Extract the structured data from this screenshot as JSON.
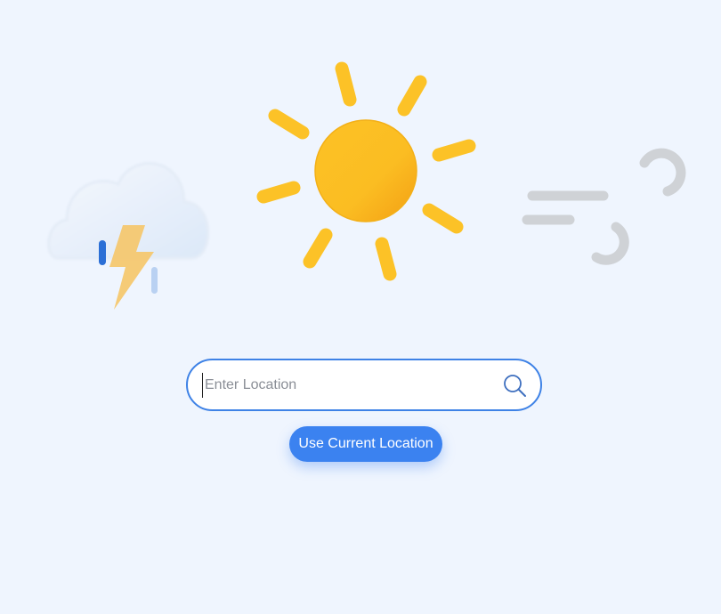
{
  "illustrations": {
    "left": "thunderstorm-icon",
    "center": "sun-icon",
    "right": "wind-icon"
  },
  "search": {
    "placeholder": "Enter Location",
    "value": "",
    "icon": "search-icon"
  },
  "location_button": {
    "label": "Use Current Location"
  },
  "colors": {
    "background": "#eff5fe",
    "accent": "#3b82f0",
    "sun": "#fbbf24",
    "sun_ray": "#fcc227",
    "lightning": "#f5c76b",
    "wind": "#cfd2d6"
  }
}
